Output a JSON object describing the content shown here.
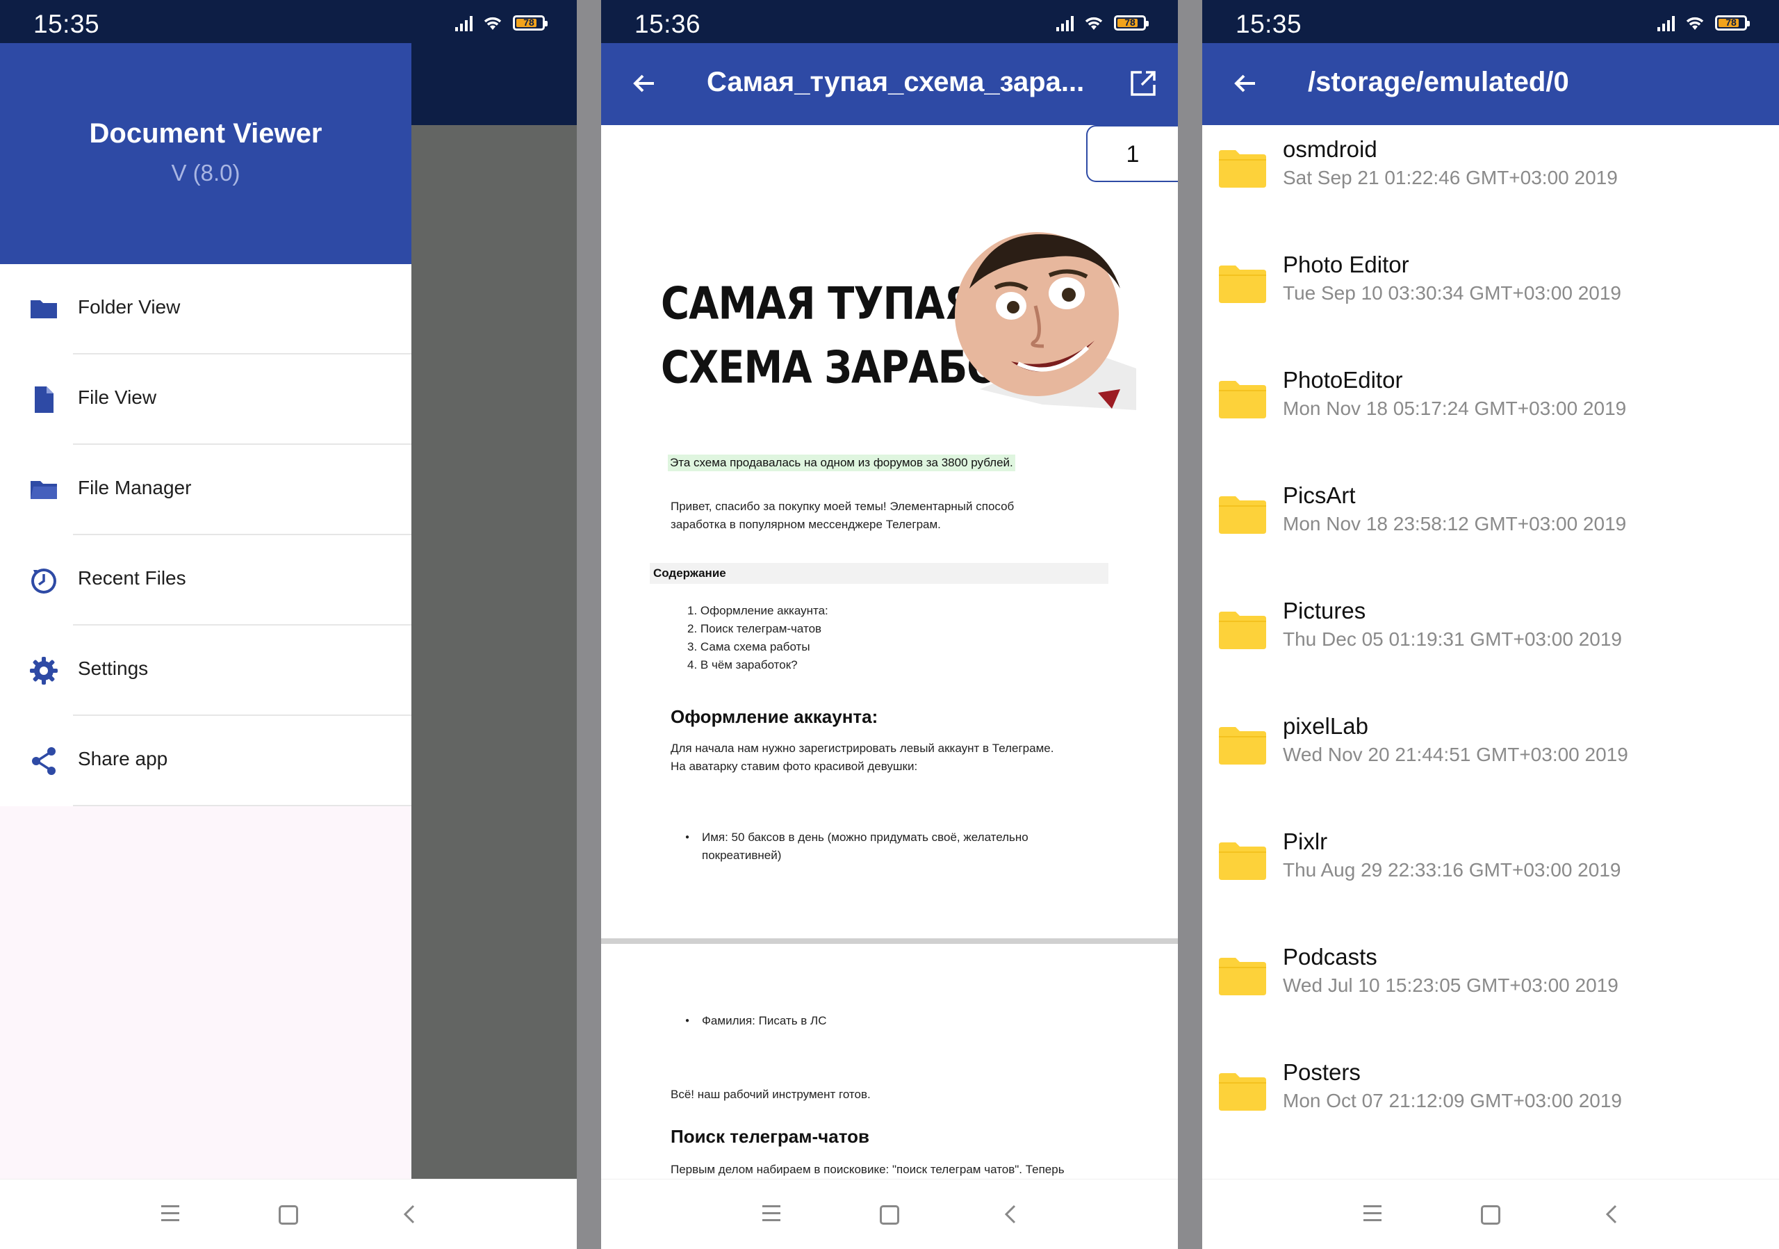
{
  "screens": {
    "drawer": {
      "time": "15:35",
      "battery": "78",
      "app_name": "Document Viewer",
      "version": "V (8.0)",
      "menu": [
        {
          "label": "Folder View",
          "icon": "folder-icon"
        },
        {
          "label": "File View",
          "icon": "file-icon"
        },
        {
          "label": "File Manager",
          "icon": "folder-open-icon"
        },
        {
          "label": "Recent Files",
          "icon": "clock-icon"
        },
        {
          "label": "Settings",
          "icon": "gear-icon"
        },
        {
          "label": "Share app",
          "icon": "share-icon"
        }
      ]
    },
    "document": {
      "time": "15:36",
      "battery": "78",
      "title": "Самая_тупая_схема_зара...",
      "page_number": "1",
      "heading_line1": "САМАЯ ТУПАЯ",
      "heading_line2": "СХЕМА ЗАРАБОТКА",
      "highlight": "Эта схема продавалась на одном из форумов за 3800 рублей.",
      "intro_line1": "Привет, спасибо за покупку моей темы! Элементарный способ",
      "intro_line2": "заработка в популярном мессенджере Телеграм.",
      "toc_title": "Содержание",
      "toc": [
        "1.  Оформление аккаунта:",
        "2.  Поиск телеграм-чатов",
        "3.  Сама схема работы",
        "4.  В чём заработок?"
      ],
      "section1": "Оформление аккаунта:",
      "section1_line1": "Для начала нам нужно зарегистрировать левый аккаунт в Телеграме.",
      "section1_line2": "На аватарку ставим фото красивой девушки:",
      "bullet1_line1": "Имя: 50 баксов в день (можно придумать своё, желательно",
      "bullet1_line2": "покреативней)",
      "bullet2": "Фамилия: Писать в ЛС",
      "ready_text": "Всё! наш рабочий инструмент готов.",
      "section2": "Поиск телеграм-чатов",
      "section2_line1": "Первым делом набираем в поисковике: \"поиск телеграм чатов\". Теперь"
    },
    "files": {
      "time": "15:35",
      "battery": "78",
      "path": "/storage/emulated/0",
      "folders": [
        {
          "name": "osmdroid",
          "date": "Sat Sep 21 01:22:46 GMT+03:00 2019"
        },
        {
          "name": "Photo Editor",
          "date": "Tue Sep 10 03:30:34 GMT+03:00 2019"
        },
        {
          "name": "PhotoEditor",
          "date": "Mon Nov 18 05:17:24 GMT+03:00 2019"
        },
        {
          "name": "PicsArt",
          "date": "Mon Nov 18 23:58:12 GMT+03:00 2019"
        },
        {
          "name": "Pictures",
          "date": "Thu Dec 05 01:19:31 GMT+03:00 2019"
        },
        {
          "name": "pixelLab",
          "date": "Wed Nov 20 21:44:51 GMT+03:00 2019"
        },
        {
          "name": "Pixlr",
          "date": "Thu Aug 29 22:33:16 GMT+03:00 2019"
        },
        {
          "name": "Podcasts",
          "date": "Wed Jul 10 15:23:05 GMT+03:00 2019"
        },
        {
          "name": "Posters",
          "date": "Mon Oct 07 21:12:09 GMT+03:00 2019"
        }
      ]
    }
  },
  "colors": {
    "primary": "#2e4aa5",
    "status_bar": "#0d1e45",
    "folder_yellow": "#fdd23a",
    "highlight_green": "#dff5df"
  }
}
